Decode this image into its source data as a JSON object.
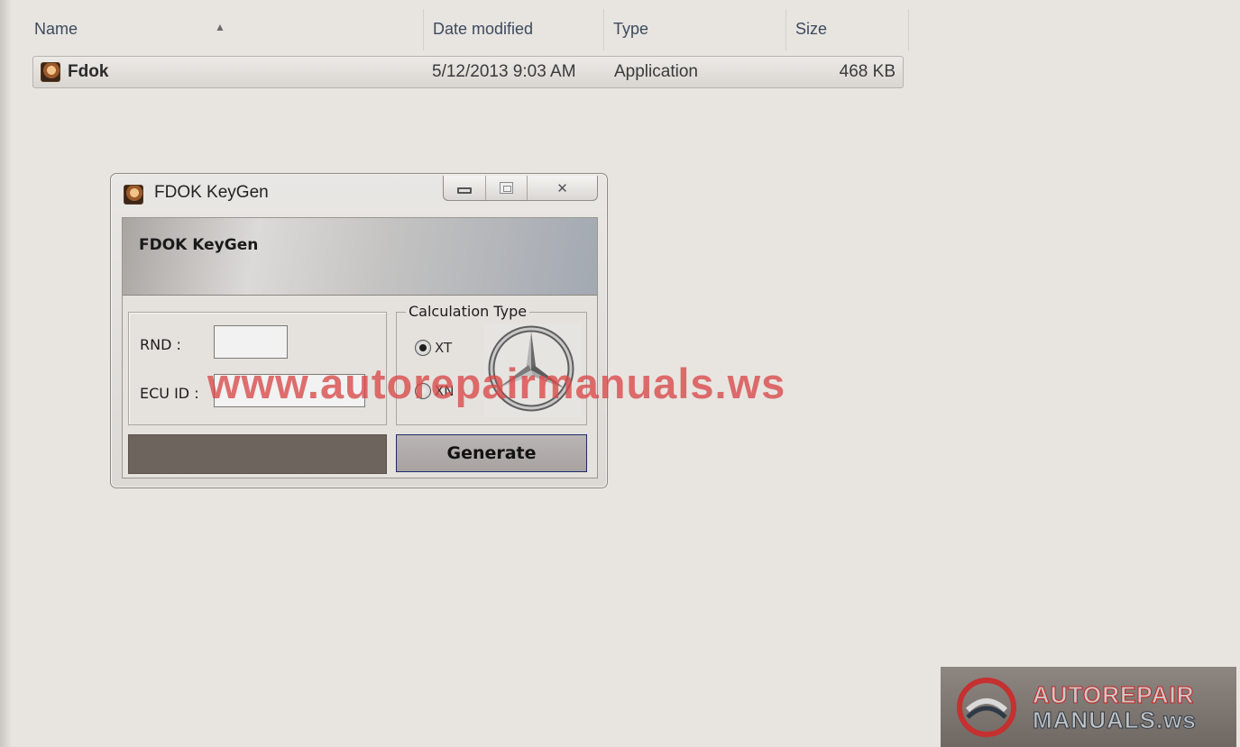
{
  "explorer": {
    "columns": {
      "name": "Name",
      "date": "Date modified",
      "type": "Type",
      "size": "Size"
    },
    "files": [
      {
        "name": "Fdok",
        "date": "5/12/2013 9:03 AM",
        "type": "Application",
        "size": "468 KB"
      }
    ]
  },
  "keygen": {
    "window_title": "FDOK KeyGen",
    "banner_title": "FDOK KeyGen",
    "rnd_label": "RND :",
    "rnd_value": "",
    "ecu_label": "ECU ID :",
    "ecu_value": "",
    "calc_type_label": "Calculation Type",
    "options": [
      {
        "label": "XT",
        "selected": true
      },
      {
        "label": "XN",
        "selected": false
      }
    ],
    "generate_label": "Generate",
    "close_glyph": "✕"
  },
  "watermarks": {
    "center": "www.autorepairmanuals.ws",
    "corner_top": "AUTOREPAIR",
    "corner_bottom": "MANUALS.ws"
  },
  "colors": {
    "watermark_red": "#d84848",
    "generate_border": "#1c2a6c",
    "progress_fill": "#6e645e"
  }
}
